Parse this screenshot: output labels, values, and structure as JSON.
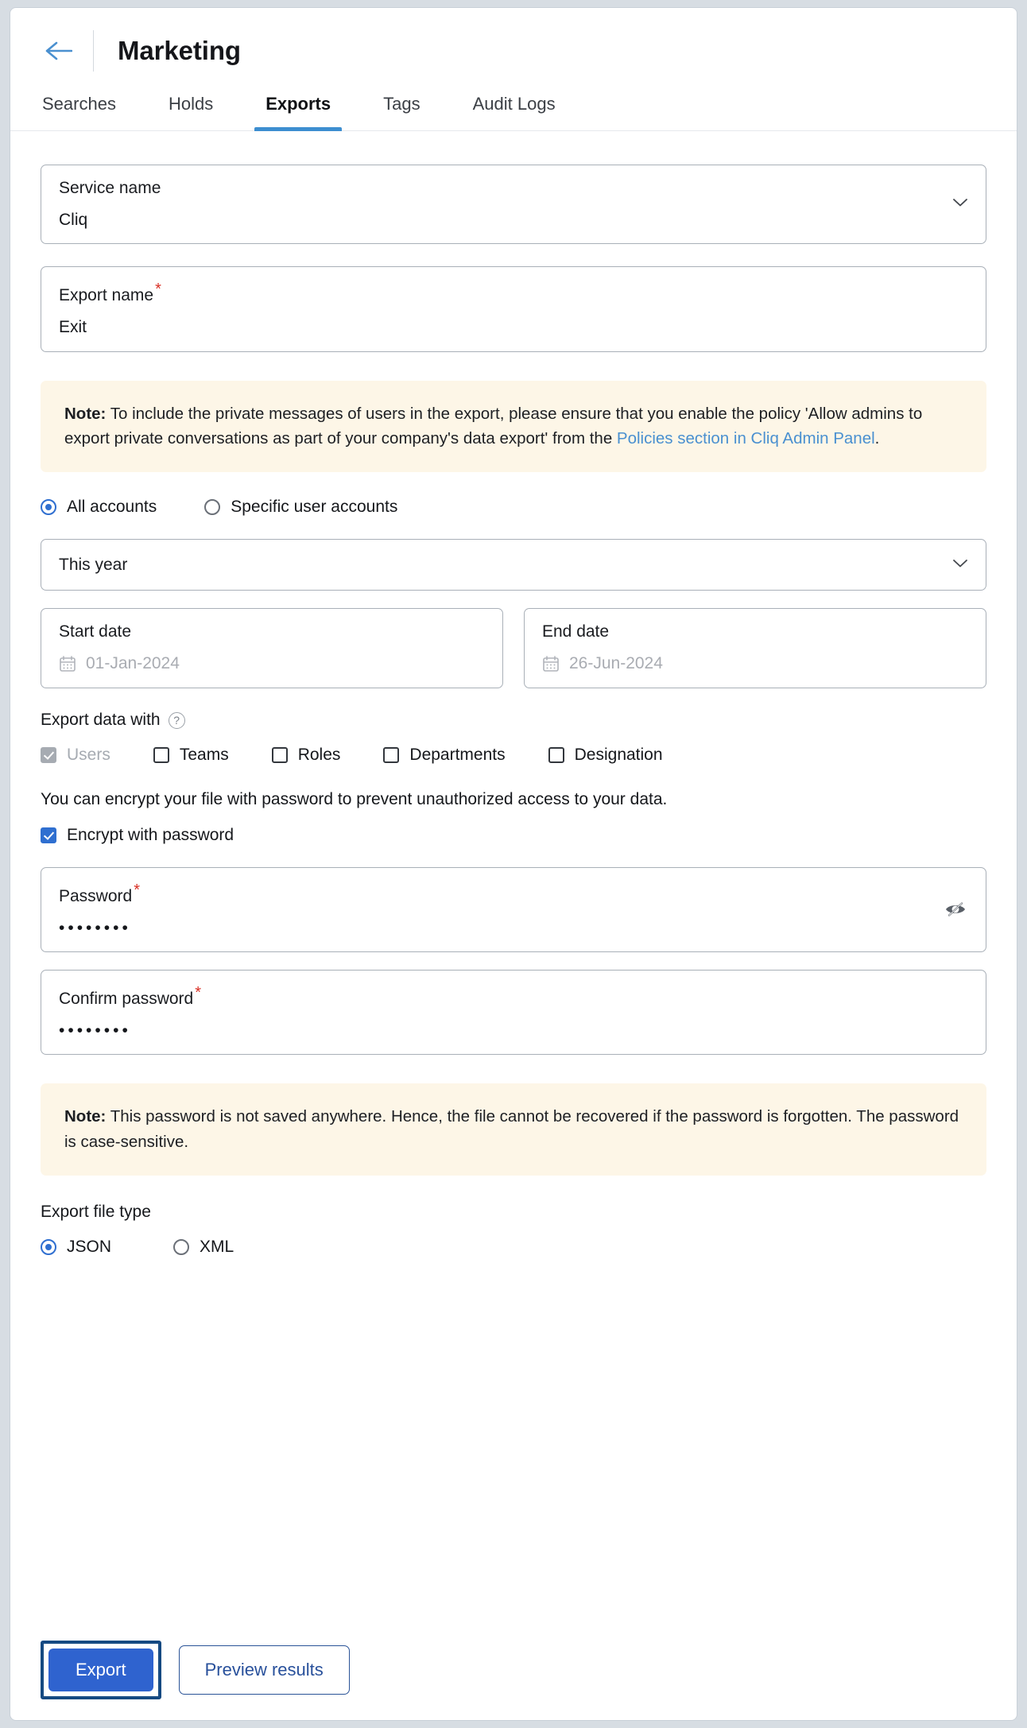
{
  "header": {
    "back_icon": "arrow-left-icon",
    "title": "Marketing"
  },
  "tabs": [
    {
      "label": "Searches",
      "active": false
    },
    {
      "label": "Holds",
      "active": false
    },
    {
      "label": "Exports",
      "active": true
    },
    {
      "label": "Tags",
      "active": false
    },
    {
      "label": "Audit Logs",
      "active": false
    }
  ],
  "form": {
    "service_name": {
      "label": "Service name",
      "value": "Cliq",
      "icon": "chevron-down-icon"
    },
    "export_name": {
      "label": "Export name",
      "required_marker": "*",
      "value": "Exit"
    },
    "note_private": {
      "bold_prefix": "Note:",
      "text_before": " To include the private messages of users in the export, please ensure that you enable the policy 'Allow admins to export private conversations as part of your company's data export' from the ",
      "link_text": "Policies section in Cliq Admin Panel",
      "text_after": "."
    },
    "account_scope": {
      "options": [
        {
          "label": "All accounts",
          "selected": true
        },
        {
          "label": "Specific user accounts",
          "selected": false
        }
      ]
    },
    "date_range": {
      "label": "This year",
      "icon": "chevron-down-icon"
    },
    "start_date": {
      "label": "Start date",
      "value": "01-Jan-2024",
      "icon": "calendar-icon"
    },
    "end_date": {
      "label": "End date",
      "value": "26-Jun-2024",
      "icon": "calendar-icon"
    },
    "export_data_with": {
      "label": "Export data with",
      "help_icon": "help-circle-icon",
      "options": [
        {
          "label": "Users",
          "checked": true,
          "disabled": true
        },
        {
          "label": "Teams",
          "checked": false,
          "disabled": false
        },
        {
          "label": "Roles",
          "checked": false,
          "disabled": false
        },
        {
          "label": "Departments",
          "checked": false,
          "disabled": false
        },
        {
          "label": "Designation",
          "checked": false,
          "disabled": false
        }
      ]
    },
    "encryption": {
      "description": "You can encrypt your file with password to prevent unauthorized access to your data.",
      "checkbox_label": "Encrypt with password",
      "checked": true
    },
    "password": {
      "label": "Password",
      "required_marker": "*",
      "value": "••••••••",
      "toggle_icon": "eye-off-icon"
    },
    "confirm_password": {
      "label": "Confirm password",
      "required_marker": "*",
      "value": "••••••••"
    },
    "note_password": {
      "bold_prefix": "Note:",
      "text": " This password is not saved anywhere. Hence, the file cannot be recovered if the password is forgotten. The password is case-sensitive."
    },
    "file_type": {
      "label": "Export file type",
      "options": [
        {
          "label": "JSON",
          "selected": true
        },
        {
          "label": "XML",
          "selected": false
        }
      ]
    }
  },
  "footer": {
    "export_label": "Export",
    "preview_label": "Preview results"
  },
  "colors": {
    "accent_blue": "#2f63cf",
    "tab_underline": "#3d8ed0",
    "link": "#4a90d0",
    "note_bg": "#fdf6e7",
    "required_red": "#d93025",
    "focus_ring": "#164a82"
  }
}
